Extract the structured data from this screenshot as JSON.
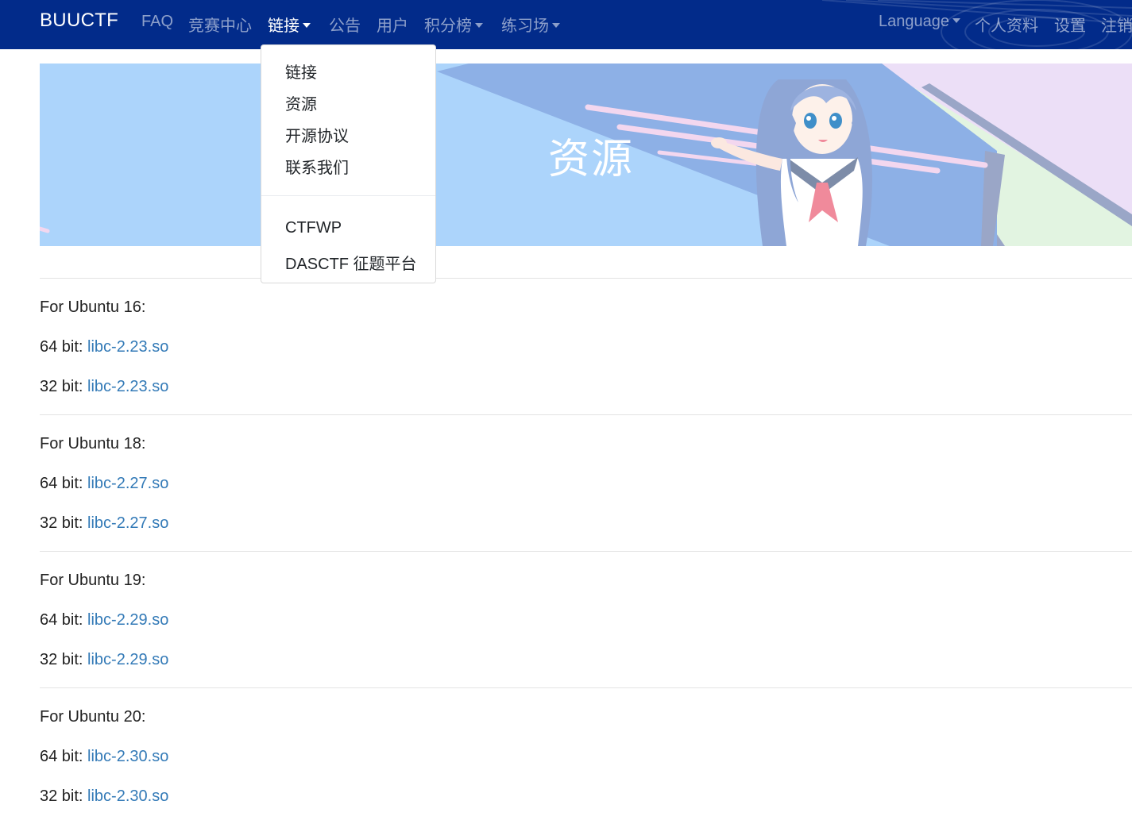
{
  "navbar": {
    "brand": "BUUCTF",
    "left_items": [
      {
        "label": "FAQ",
        "dropdown": false
      },
      {
        "label": "竞赛中心",
        "dropdown": false
      },
      {
        "label": "链接",
        "dropdown": true,
        "active": true
      },
      {
        "label": "公告",
        "dropdown": false
      },
      {
        "label": "用户",
        "dropdown": false
      },
      {
        "label": "积分榜",
        "dropdown": true
      },
      {
        "label": "练习场",
        "dropdown": true
      }
    ],
    "right_items": [
      {
        "label": "Language",
        "dropdown": true
      },
      {
        "label": "个人资料",
        "dropdown": false
      },
      {
        "label": "设置",
        "dropdown": false
      },
      {
        "label": "注销",
        "dropdown": false
      }
    ],
    "background_color": "#022b8a"
  },
  "dropdown": {
    "items": [
      "链接",
      "资源",
      "开源协议",
      "联系我们"
    ],
    "items_after_divider": [
      "CTFWP",
      "DASCTF 征题平台"
    ]
  },
  "banner": {
    "title": "资源",
    "illustration": "anime-girl-pointing"
  },
  "sections": [
    {
      "heading": "For Ubuntu 16:",
      "rows": [
        {
          "prefix": "64 bit: ",
          "link": "libc-2.23.so"
        },
        {
          "prefix": "32 bit: ",
          "link": "libc-2.23.so"
        }
      ]
    },
    {
      "heading": "For Ubuntu 18:",
      "rows": [
        {
          "prefix": "64 bit: ",
          "link": "libc-2.27.so"
        },
        {
          "prefix": "32 bit: ",
          "link": "libc-2.27.so"
        }
      ]
    },
    {
      "heading": "For Ubuntu 19:",
      "rows": [
        {
          "prefix": "64 bit: ",
          "link": "libc-2.29.so"
        },
        {
          "prefix": "32 bit: ",
          "link": "libc-2.29.so"
        }
      ]
    },
    {
      "heading": "For Ubuntu 20:",
      "rows": [
        {
          "prefix": "64 bit: ",
          "link": "libc-2.30.so"
        },
        {
          "prefix": "32 bit: ",
          "link": "libc-2.30.so"
        }
      ]
    }
  ],
  "colors": {
    "link": "#337ab7",
    "banner_bg": "#acd4fb"
  }
}
